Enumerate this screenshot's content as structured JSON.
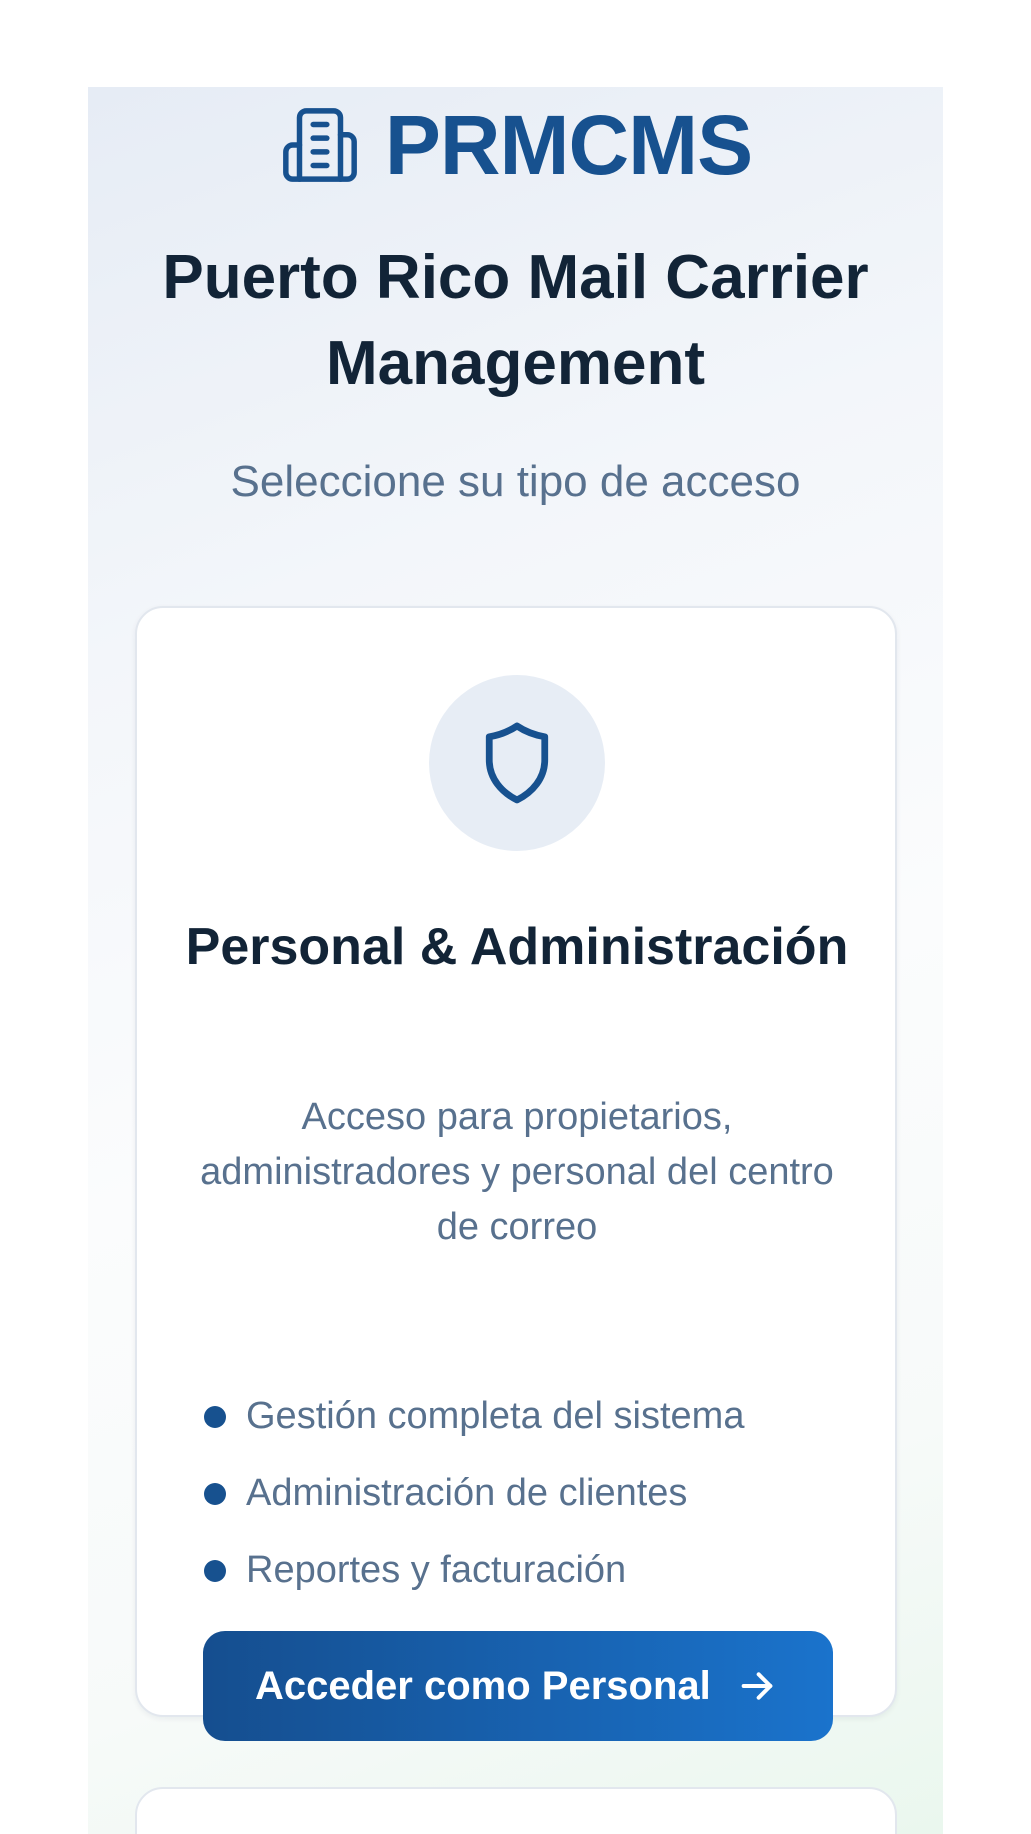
{
  "brand": {
    "icon": "building-icon",
    "name": "PRMCMS"
  },
  "header": {
    "title": "Puerto Rico Mail Carrier Management",
    "subtitle": "Seleccione su tipo de acceso"
  },
  "access_cards": [
    {
      "icon": "shield-icon",
      "title": "Personal & Administración",
      "description": "Acceso para propietarios, administradores y personal del centro de correo",
      "features": [
        "Gestión completa del sistema",
        "Administración de clientes",
        "Reportes y facturación"
      ],
      "button_label": "Acceder como Personal",
      "button_icon": "arrow-right-icon"
    }
  ],
  "colors": {
    "brand": "#17518f",
    "heading": "#122437",
    "muted_text": "#58718e",
    "button_start": "#154e8f",
    "button_end": "#1a73cc",
    "icon_circle_bg": "#e7edf5"
  }
}
